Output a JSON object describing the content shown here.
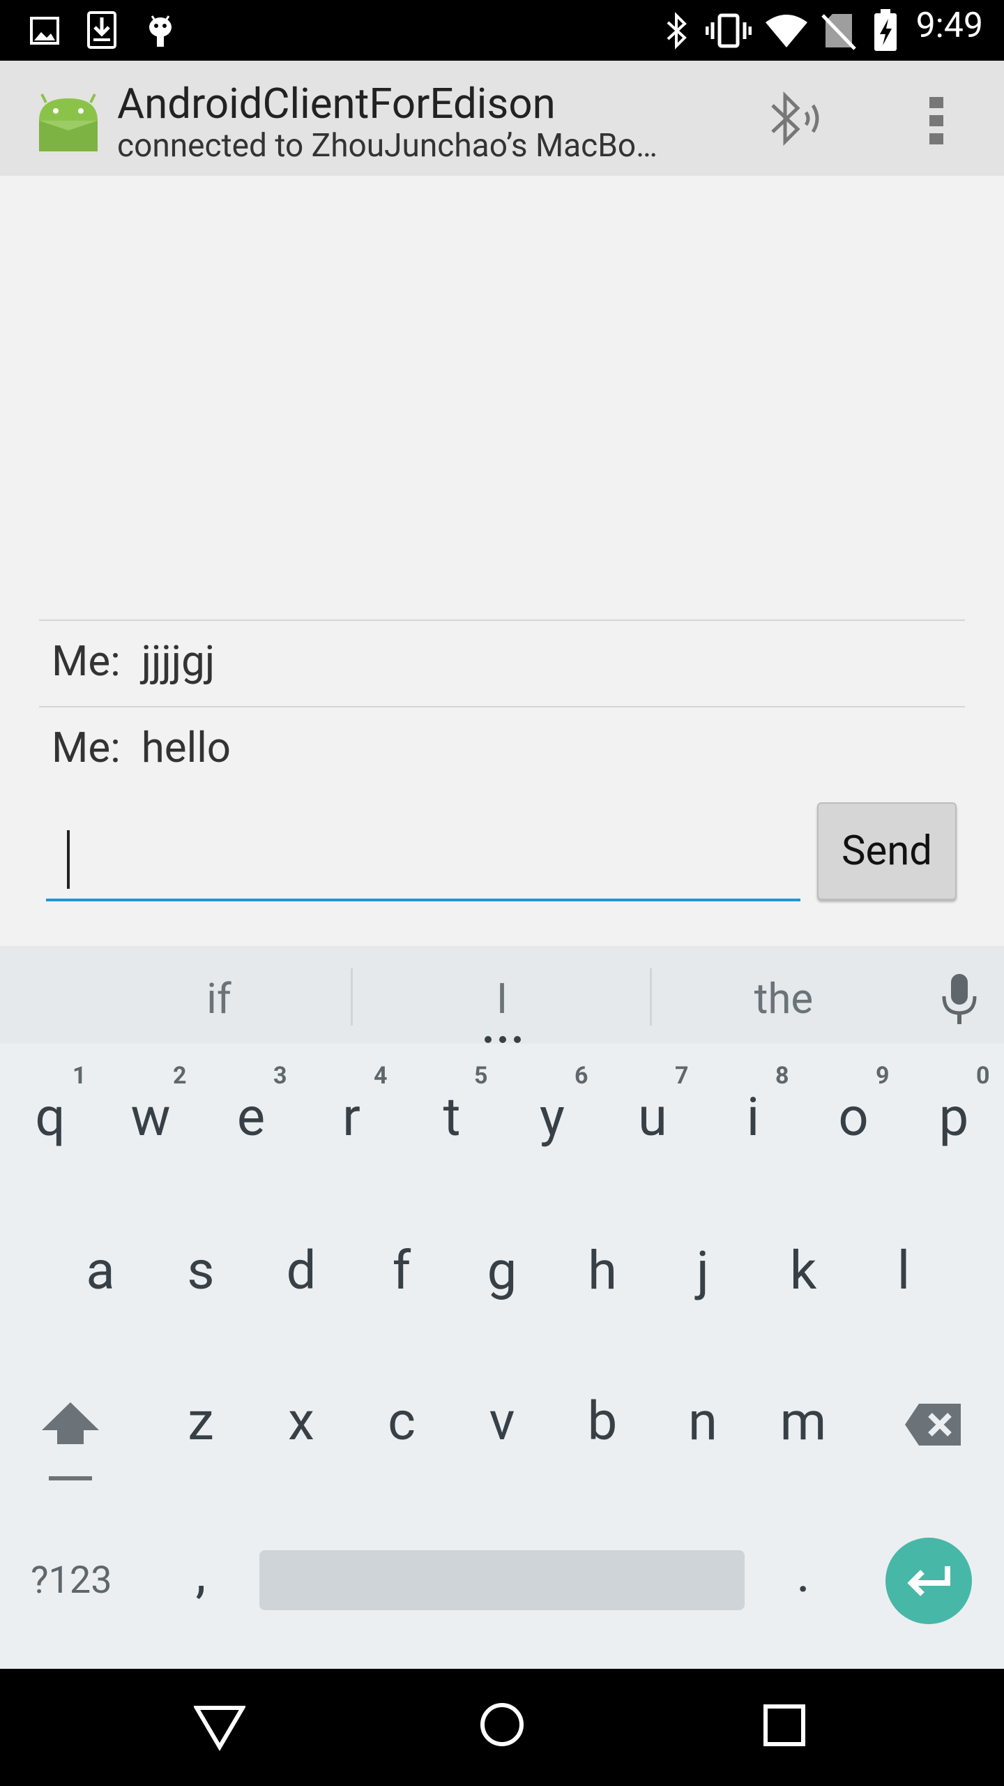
{
  "status_bar": {
    "time": "9:49",
    "left_icons": [
      "image-icon",
      "download-icon",
      "android-debug-icon"
    ],
    "right_icons": [
      "bluetooth-icon",
      "vibrate-icon",
      "wifi-icon",
      "no-sim-icon",
      "battery-charging-icon"
    ]
  },
  "app_bar": {
    "title": "AndroidClientForEdison",
    "subtitle": "connected to ZhouJunchao’s MacBo…",
    "icons": [
      "android-logo-icon",
      "bluetooth-audio-icon",
      "overflow-menu-icon"
    ]
  },
  "messages": [
    {
      "sender": "Me:",
      "text": "jjjjgj"
    },
    {
      "sender": "Me:",
      "text": "hello"
    }
  ],
  "input": {
    "value": "",
    "placeholder": ""
  },
  "send_label": "Send",
  "keyboard": {
    "suggestions": [
      "if",
      "I",
      "the"
    ],
    "row1": [
      "q",
      "w",
      "e",
      "r",
      "t",
      "y",
      "u",
      "i",
      "o",
      "p"
    ],
    "row1_hints": [
      "1",
      "2",
      "3",
      "4",
      "5",
      "6",
      "7",
      "8",
      "9",
      "0"
    ],
    "row2": [
      "a",
      "s",
      "d",
      "f",
      "g",
      "h",
      "j",
      "k",
      "l"
    ],
    "row3": [
      "z",
      "x",
      "c",
      "v",
      "b",
      "n",
      "m"
    ],
    "symbols_label": "?123",
    "comma": ",",
    "period": ".",
    "accent_color": "#47b7a8"
  },
  "nav_bar": {
    "icons": [
      "back-icon",
      "home-icon",
      "recents-icon"
    ]
  }
}
